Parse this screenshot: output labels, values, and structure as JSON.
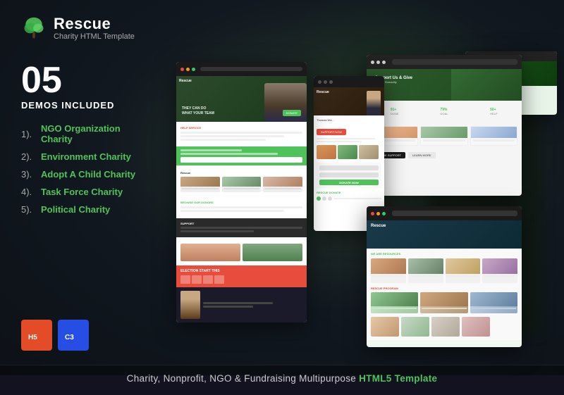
{
  "brand": {
    "logo_title": "Rescue",
    "logo_subtitle": "Charity HTML Template",
    "tree_icon": "🌳"
  },
  "demos": {
    "count": "05",
    "label": "DEMOS INCLUDED",
    "list": [
      {
        "number": "1).",
        "name": "NGO Organization Charity"
      },
      {
        "number": "2).",
        "name": "Environment Charity"
      },
      {
        "number": "3).",
        "name": "Adopt A Child Charity"
      },
      {
        "number": "4).",
        "name": "Task Force Charity"
      },
      {
        "number": "5).",
        "name": "Political Charity"
      }
    ]
  },
  "badges": {
    "html5": "HTML5",
    "css3": "CSS3"
  },
  "footer": {
    "text": "Charity, Nonprofit, NGO & Fundraising Multipurpose ",
    "highlight": "HTML5 Template"
  },
  "colors": {
    "accent": "#4fc35a",
    "dark_bg": "#1a1a2e",
    "html5": "#e34c26",
    "css3": "#264de4"
  }
}
